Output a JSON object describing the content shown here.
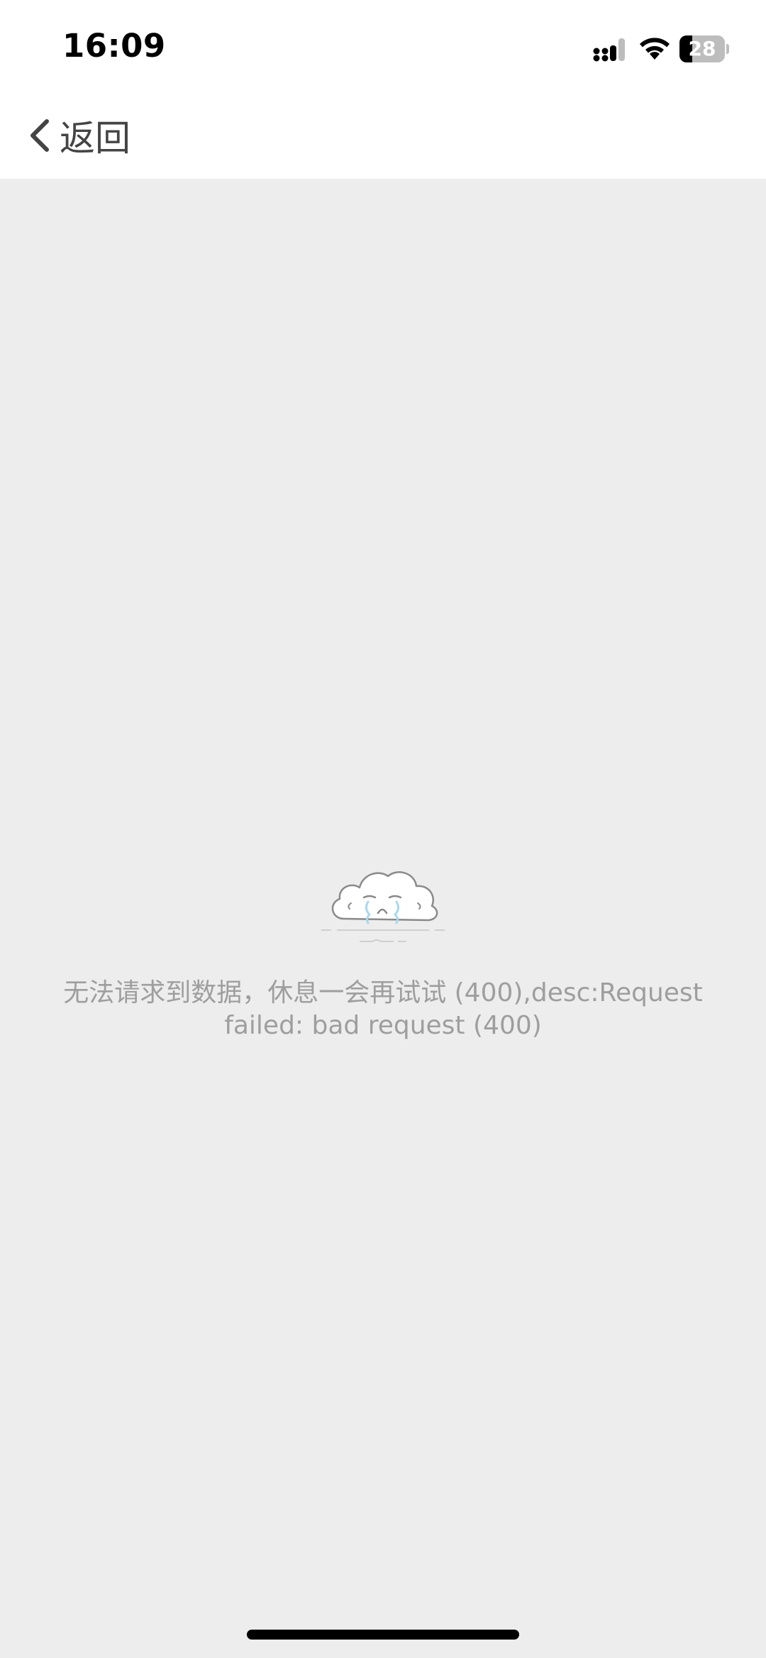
{
  "status_bar": {
    "time": "16:09",
    "signal_icon": "cellular-signal-icon",
    "wifi_icon": "wifi-icon",
    "battery_level": "28",
    "battery_fraction": 0.28
  },
  "nav": {
    "back_icon": "chevron-left-icon",
    "back_label": "返回"
  },
  "empty_state": {
    "illustration": "crying-cloud-icon",
    "message": "无法请求到数据，休息一会再试试 (400),desc:Request failed: bad request (400)"
  },
  "colors": {
    "background": "#ededed",
    "topbar": "#ffffff",
    "message_text": "#9e9e9e",
    "back_text": "#444444",
    "tear_blue": "#a9d8ee"
  }
}
